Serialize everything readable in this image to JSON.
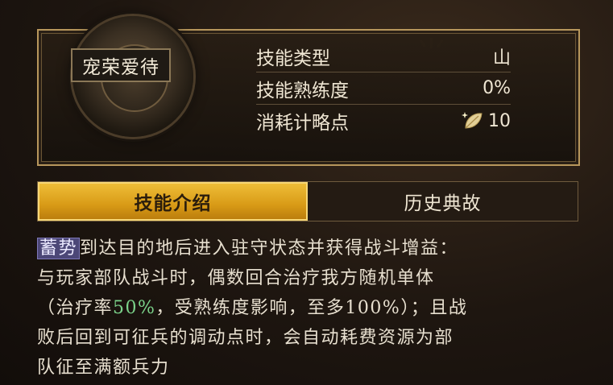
{
  "skill": {
    "name": "宠荣爱待",
    "stats": [
      {
        "label": "技能类型",
        "value": "山"
      },
      {
        "label": "技能熟练度",
        "value": "0%"
      },
      {
        "label": "消耗计略点",
        "value": "10",
        "icon": "leaf-icon"
      }
    ]
  },
  "tabs": [
    {
      "label": "技能介绍",
      "active": true
    },
    {
      "label": "历史典故",
      "active": false
    }
  ],
  "description": {
    "keyword": "蓄势",
    "line1_rest": "到达目的地后进入驻守状态并获得战斗增益：",
    "line2": "与玩家部队战斗时，偶数回合治疗我方随机单体",
    "line3_a": "（治疗率",
    "line3_highlight": "50%",
    "line3_b": "，受熟练度影响，至多100%）；且战",
    "line4": "败后回到可征兵的调动点时，会自动耗费资源为部",
    "line5": "队征至满额兵力"
  },
  "colors": {
    "accent_gold": "#d89a16",
    "frame": "#b8975c",
    "keyword_bg": "#4c4777",
    "highlight_green": "#7bd28a"
  }
}
